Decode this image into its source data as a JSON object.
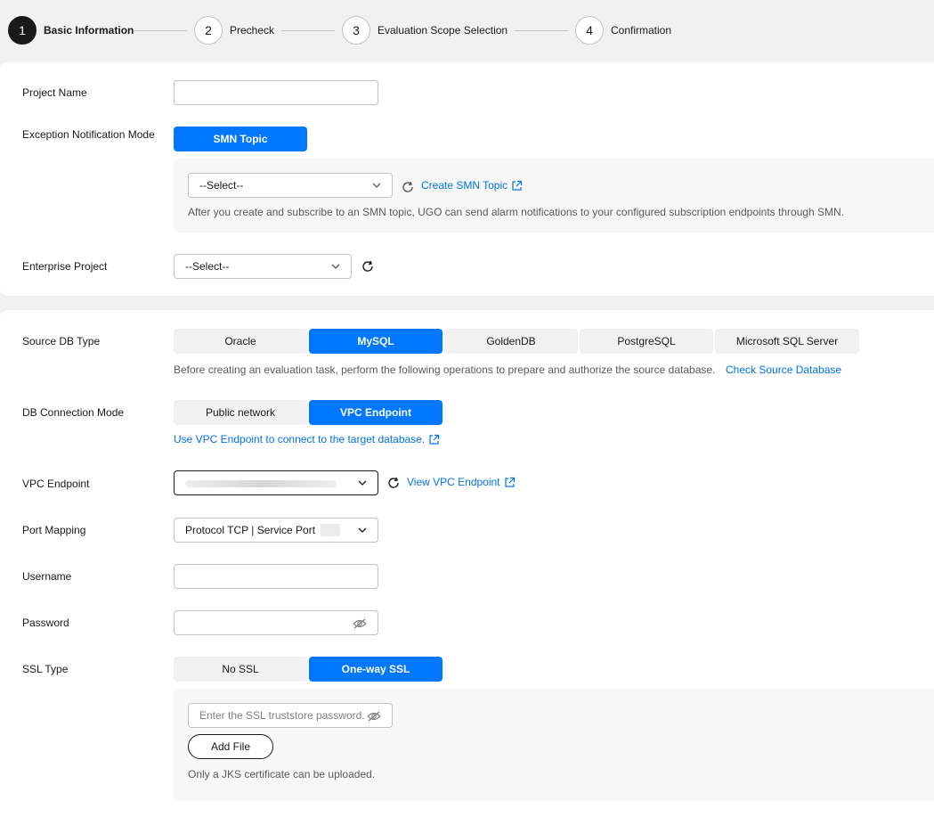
{
  "stepper": {
    "steps": [
      {
        "num": "1",
        "label": "Basic Information"
      },
      {
        "num": "2",
        "label": "Precheck"
      },
      {
        "num": "3",
        "label": "Evaluation Scope Selection"
      },
      {
        "num": "4",
        "label": "Confirmation"
      }
    ],
    "active": 1
  },
  "basic": {
    "project_name_label": "Project Name",
    "project_name_value": "",
    "exception_mode_label": "Exception Notification Mode",
    "smn_topic_button": "SMN Topic",
    "smn_select_value": "--Select--",
    "create_smn_link": "Create SMN Topic",
    "smn_hint": "After you create and subscribe to an SMN topic, UGO can send alarm notifications to your configured subscription endpoints through SMN.",
    "enterprise_project_label": "Enterprise Project",
    "enterprise_select_value": "--Select--"
  },
  "source": {
    "db_type_label": "Source DB Type",
    "db_types": [
      "Oracle",
      "MySQL",
      "GoldenDB",
      "PostgreSQL",
      "Microsoft SQL Server"
    ],
    "db_type_selected": "MySQL",
    "db_type_hint": "Before creating an evaluation task, perform the following operations to prepare and authorize the source database.",
    "check_source_link": "Check Source Database",
    "conn_mode_label": "DB Connection Mode",
    "conn_modes": [
      "Public network",
      "VPC Endpoint"
    ],
    "conn_mode_selected": "VPC Endpoint",
    "vpc_hint_link": "Use VPC Endpoint to connect to the target database.",
    "vpc_endpoint_label": "VPC Endpoint",
    "view_vpc_link": "View VPC Endpoint",
    "port_mapping_label": "Port Mapping",
    "port_mapping_value": "Protocol TCP | Service Port",
    "username_label": "Username",
    "username_value": "",
    "password_label": "Password",
    "password_value": "",
    "ssl_type_label": "SSL Type",
    "ssl_types": [
      "No SSL",
      "One-way SSL"
    ],
    "ssl_type_selected": "One-way SSL",
    "ssl_password_placeholder": "Enter the SSL truststore password.",
    "add_file_button": "Add File",
    "ssl_hint": "Only a JKS certificate can be uploaded."
  },
  "colors": {
    "primary": "#0077ff",
    "link": "#0073e6",
    "text": "#191919",
    "muted": "#595959"
  }
}
